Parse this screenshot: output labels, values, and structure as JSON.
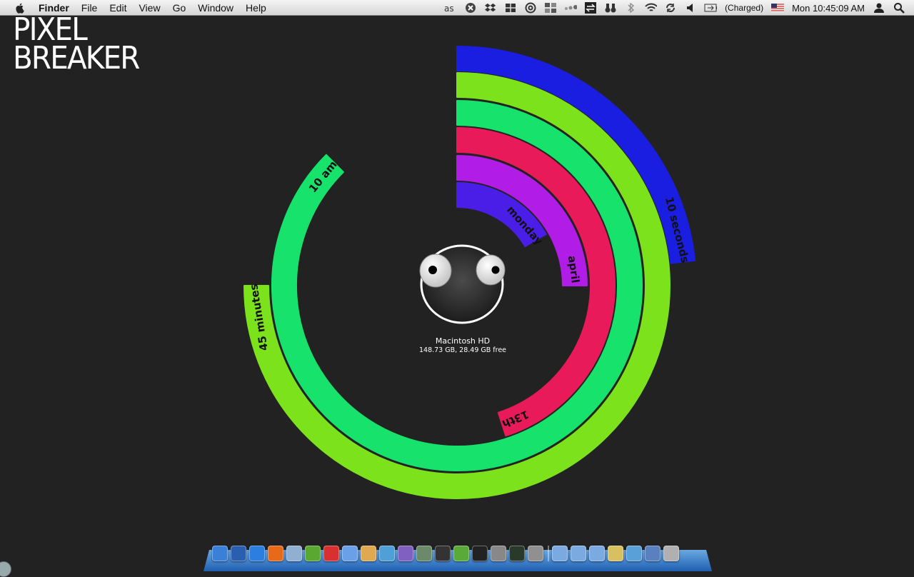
{
  "menubar": {
    "app_name": "Finder",
    "menus": [
      "File",
      "Edit",
      "View",
      "Go",
      "Window",
      "Help"
    ],
    "status_icons": [
      "lastfm-icon",
      "close-circle-icon",
      "dropbox-icon",
      "grid-icon",
      "at-icon",
      "windows-grid-icon",
      "dots-icon",
      "arrows-icon",
      "binoculars-icon",
      "bluetooth-icon",
      "wifi-icon",
      "sync-icon",
      "volume-icon"
    ],
    "battery": "(Charged)",
    "flag_icon": "us-flag-icon",
    "clock": "Mon 10:45:09 AM",
    "user_icon": "user-icon",
    "spotlight_icon": "spotlight-icon"
  },
  "logo": {
    "line1": "PIXEL",
    "line2": "BREAKER"
  },
  "clock_rings": [
    {
      "label": "10 seconds",
      "color": "#1a1ee0",
      "fraction": 0.2333
    },
    {
      "label": "45 minutes",
      "color": "#7ce21b",
      "fraction": 0.75
    },
    {
      "label": "10 am",
      "color": "#17e26b",
      "fraction": 0.875
    },
    {
      "label": "13th",
      "color": "#e81a5a",
      "fraction": 0.45
    },
    {
      "label": "april",
      "color": "#b11de6",
      "fraction": 0.25
    },
    {
      "label": "monday",
      "color": "#4a1ee6",
      "fraction": 0.1667
    }
  ],
  "drive": {
    "name": "Macintosh HD",
    "info": "148.73 GB, 28.49 GB free"
  },
  "dock": {
    "items": [
      {
        "name": "finder-icon",
        "color": "#3a7fd8"
      },
      {
        "name": "dashboard-icon",
        "color": "#2a5fb0"
      },
      {
        "name": "safari-icon",
        "color": "#2c7fe0"
      },
      {
        "name": "firefox-icon",
        "color": "#e66a1a"
      },
      {
        "name": "mail-icon",
        "color": "#8fb0d0"
      },
      {
        "name": "ichat-icon",
        "color": "#5aa830"
      },
      {
        "name": "calendar-icon",
        "color": "#d83030"
      },
      {
        "name": "itunes-icon",
        "color": "#6aa0e8"
      },
      {
        "name": "preview-icon",
        "color": "#e0a850"
      },
      {
        "name": "photos-icon",
        "color": "#50a0d8"
      },
      {
        "name": "stamp-icon",
        "color": "#8060c0"
      },
      {
        "name": "iphoto-icon",
        "color": "#6a8a6a"
      },
      {
        "name": "pixelbreaker-icon",
        "color": "#333333"
      },
      {
        "name": "leaf-icon",
        "color": "#5aaa3a"
      },
      {
        "name": "terminal-icon",
        "color": "#222222"
      },
      {
        "name": "system-preferences-icon",
        "color": "#888888"
      },
      {
        "name": "activity-monitor-icon",
        "color": "#2a3a2a"
      },
      {
        "name": "trash-device-icon",
        "color": "#909090"
      },
      {
        "name": "applications-folder-icon",
        "color": "#7aaae0"
      },
      {
        "name": "downloads-folder-icon",
        "color": "#7aaae0"
      },
      {
        "name": "documents-folder-icon",
        "color": "#7aaae0"
      },
      {
        "name": "user-folder-icon",
        "color": "#d8c060"
      },
      {
        "name": "network-icon",
        "color": "#5aa0d8"
      },
      {
        "name": "stack-icon",
        "color": "#5a80c0"
      },
      {
        "name": "trash-icon",
        "color": "#b0b0b0"
      }
    ]
  }
}
